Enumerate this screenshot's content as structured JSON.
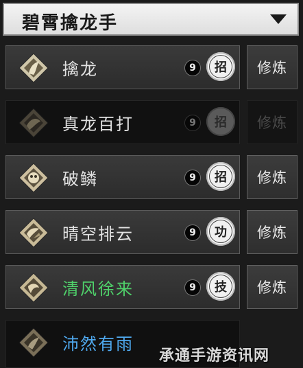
{
  "header": {
    "title": "碧霄擒龙手"
  },
  "skills": [
    {
      "name": "擒龙",
      "level": "9",
      "type": "招",
      "action": "修炼",
      "name_color": "#e2e2e2"
    },
    {
      "name": "真龙百打",
      "level": "9",
      "type": "招",
      "action": "修炼",
      "name_color": "#e2e2e2"
    },
    {
      "name": "破鳞",
      "level": "9",
      "type": "招",
      "action": "修炼",
      "name_color": "#e2e2e2"
    },
    {
      "name": "晴空排云",
      "level": "9",
      "type": "功",
      "action": "修炼",
      "name_color": "#e2e2e2"
    },
    {
      "name": "清风徐来",
      "level": "9",
      "type": "技",
      "action": "修炼",
      "name_color": "#4fd06a"
    },
    {
      "name": "沛然有雨",
      "name_color": "#4fa9ef"
    }
  ],
  "watermark": "承通手游资讯网"
}
